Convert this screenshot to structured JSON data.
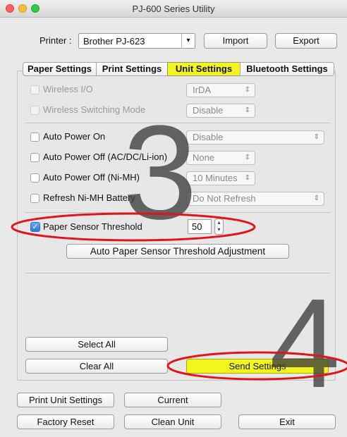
{
  "window": {
    "title": "PJ-600 Series Utility"
  },
  "printer": {
    "label": "Printer :",
    "selected": "Brother PJ-623",
    "import_label": "Import",
    "export_label": "Export"
  },
  "tabs": [
    "Paper Settings",
    "Print Settings",
    "Unit Settings",
    "Bluetooth Settings"
  ],
  "active_tab": "Unit Settings",
  "unit_settings": {
    "wireless_io": {
      "label": "Wireless I/O",
      "value": "IrDA"
    },
    "wireless_switching": {
      "label": "Wireless Switching Mode",
      "value": "Disable"
    },
    "auto_power_on": {
      "label": "Auto Power On",
      "value": "Disable"
    },
    "auto_power_off_ac": {
      "label": "Auto Power Off (AC/DC/Li-ion)",
      "value": "None"
    },
    "auto_power_off_nimh": {
      "label": "Auto Power Off (Ni-MH)",
      "value": "10 Minutes"
    },
    "refresh_nimh": {
      "label": "Refresh Ni-MH Battery",
      "value": "Do Not Refresh"
    },
    "paper_sensor": {
      "label": "Paper Sensor Threshold",
      "value": "50",
      "checked": true
    },
    "auto_adjust_label": "Auto Paper Sensor Threshold Adjustment"
  },
  "panel_buttons": {
    "select_all": "Select All",
    "clear_all": "Clear All",
    "send_settings": "Send Settings"
  },
  "bottom_buttons": {
    "print_unit": "Print Unit Settings",
    "current": "Current",
    "factory_reset": "Factory Reset",
    "clean_unit": "Clean Unit",
    "exit": "Exit"
  },
  "annotations": {
    "step3": "3",
    "step4": "4"
  },
  "colors": {
    "highlight": "#f3f51c",
    "annotation_red": "#e0151b",
    "close": "#fc605c",
    "minimize": "#fdbc40",
    "zoom": "#34c84a"
  }
}
